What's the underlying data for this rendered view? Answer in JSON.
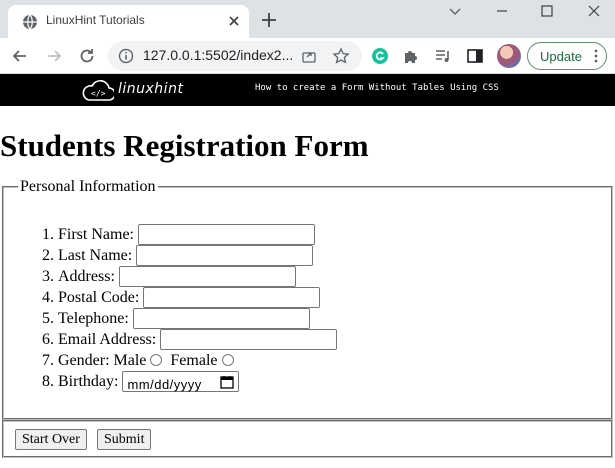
{
  "browser": {
    "tab_title": "LinuxHint Tutorials",
    "url": "127.0.0.1:5502/index2...",
    "update_label": "Update"
  },
  "banner": {
    "logo_text": "linuxhint",
    "logo_mark": "</>",
    "caption": "How to create a Form Without Tables Using CSS"
  },
  "form": {
    "title": "Students Registration Form",
    "legend": "Personal Information",
    "fields": [
      {
        "label": "First Name:",
        "value": ""
      },
      {
        "label": "Last Name:",
        "value": ""
      },
      {
        "label": "Address:",
        "value": ""
      },
      {
        "label": "Postal Code:",
        "value": ""
      },
      {
        "label": "Telephone:",
        "value": ""
      },
      {
        "label": "Email Address:",
        "value": ""
      }
    ],
    "gender_label": "Gender:",
    "gender_options": [
      "Male",
      "Female"
    ],
    "birthday_label": "Birthday:",
    "birthday_placeholder": "mm/dd/yyyy",
    "buttons": {
      "reset": "Start Over",
      "submit": "Submit"
    }
  },
  "colors": {
    "tabstrip": "#dee1e6",
    "banner": "#000000",
    "update_border": "#5f8f6b",
    "grammarly": "#15c39a"
  },
  "icons": [
    "globe-icon",
    "close-icon",
    "plus-icon",
    "back-icon",
    "forward-icon",
    "reload-icon",
    "info-icon",
    "share-icon",
    "star-icon",
    "grammarly-icon",
    "puzzle-icon",
    "media-icon",
    "sidepanel-icon",
    "calendar-icon"
  ]
}
